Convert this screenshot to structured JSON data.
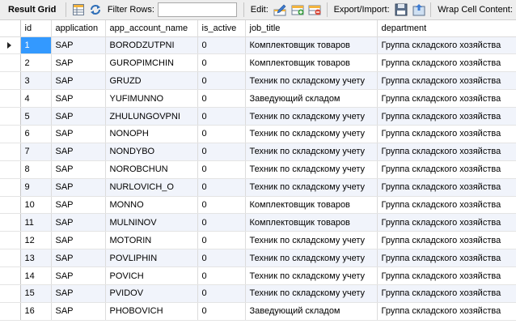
{
  "toolbar": {
    "title": "Result Grid",
    "filter_label": "Filter Rows:",
    "filter_value": "",
    "edit_label": "Edit:",
    "export_label": "Export/Import:",
    "wrap_label": "Wrap Cell Content:"
  },
  "icons": {
    "grid_form": "grid-icon",
    "refresh": "refresh-icon",
    "edit_row": "edit-row-icon",
    "add_row": "add-row-icon",
    "delete_row": "delete-row-icon",
    "export": "export-icon",
    "import": "import-icon"
  },
  "grid": {
    "columns": [
      "id",
      "application",
      "app_account_name",
      "is_active",
      "job_title",
      "department"
    ],
    "selected_row": 0,
    "rows": [
      [
        "1",
        "SAP",
        "BORODZUTPNI",
        "0",
        "Комплектовщик товаров",
        "Группа складского хозяйства"
      ],
      [
        "2",
        "SAP",
        "GUROPIMCHIN",
        "0",
        "Комплектовщик товаров",
        "Группа складского хозяйства"
      ],
      [
        "3",
        "SAP",
        "GRUZD",
        "0",
        "Техник по складскому учету",
        "Группа складского хозяйства"
      ],
      [
        "4",
        "SAP",
        "YUFIMUNNO",
        "0",
        "Заведующий складом",
        "Группа складского хозяйства"
      ],
      [
        "5",
        "SAP",
        "ZHULUNGOVPNI",
        "0",
        "Техник по складскому учету",
        "Группа складского хозяйства"
      ],
      [
        "6",
        "SAP",
        "NONOPH",
        "0",
        "Техник по складскому учету",
        "Группа складского хозяйства"
      ],
      [
        "7",
        "SAP",
        "NONDYBO",
        "0",
        "Техник по складскому учету",
        "Группа складского хозяйства"
      ],
      [
        "8",
        "SAP",
        "NOROBCHUN",
        "0",
        "Техник по складскому учету",
        "Группа складского хозяйства"
      ],
      [
        "9",
        "SAP",
        "NURLOVICH_O",
        "0",
        "Техник по складскому учету",
        "Группа складского хозяйства"
      ],
      [
        "10",
        "SAP",
        "MONNO",
        "0",
        "Комплектовщик товаров",
        "Группа складского хозяйства"
      ],
      [
        "11",
        "SAP",
        "MULNINOV",
        "0",
        "Комплектовщик товаров",
        "Группа складского хозяйства"
      ],
      [
        "12",
        "SAP",
        "MOTORIN",
        "0",
        "Техник по складскому учету",
        "Группа складского хозяйства"
      ],
      [
        "13",
        "SAP",
        "POVLIPHIN",
        "0",
        "Техник по складскому учету",
        "Группа складского хозяйства"
      ],
      [
        "14",
        "SAP",
        "POVICH",
        "0",
        "Техник по складскому учету",
        "Группа складского хозяйства"
      ],
      [
        "15",
        "SAP",
        "PVIDOV",
        "0",
        "Техник по складскому учету",
        "Группа складского хозяйства"
      ],
      [
        "16",
        "SAP",
        "PHOBOVICH",
        "0",
        "Заведующий складом",
        "Группа складского хозяйства"
      ]
    ]
  }
}
